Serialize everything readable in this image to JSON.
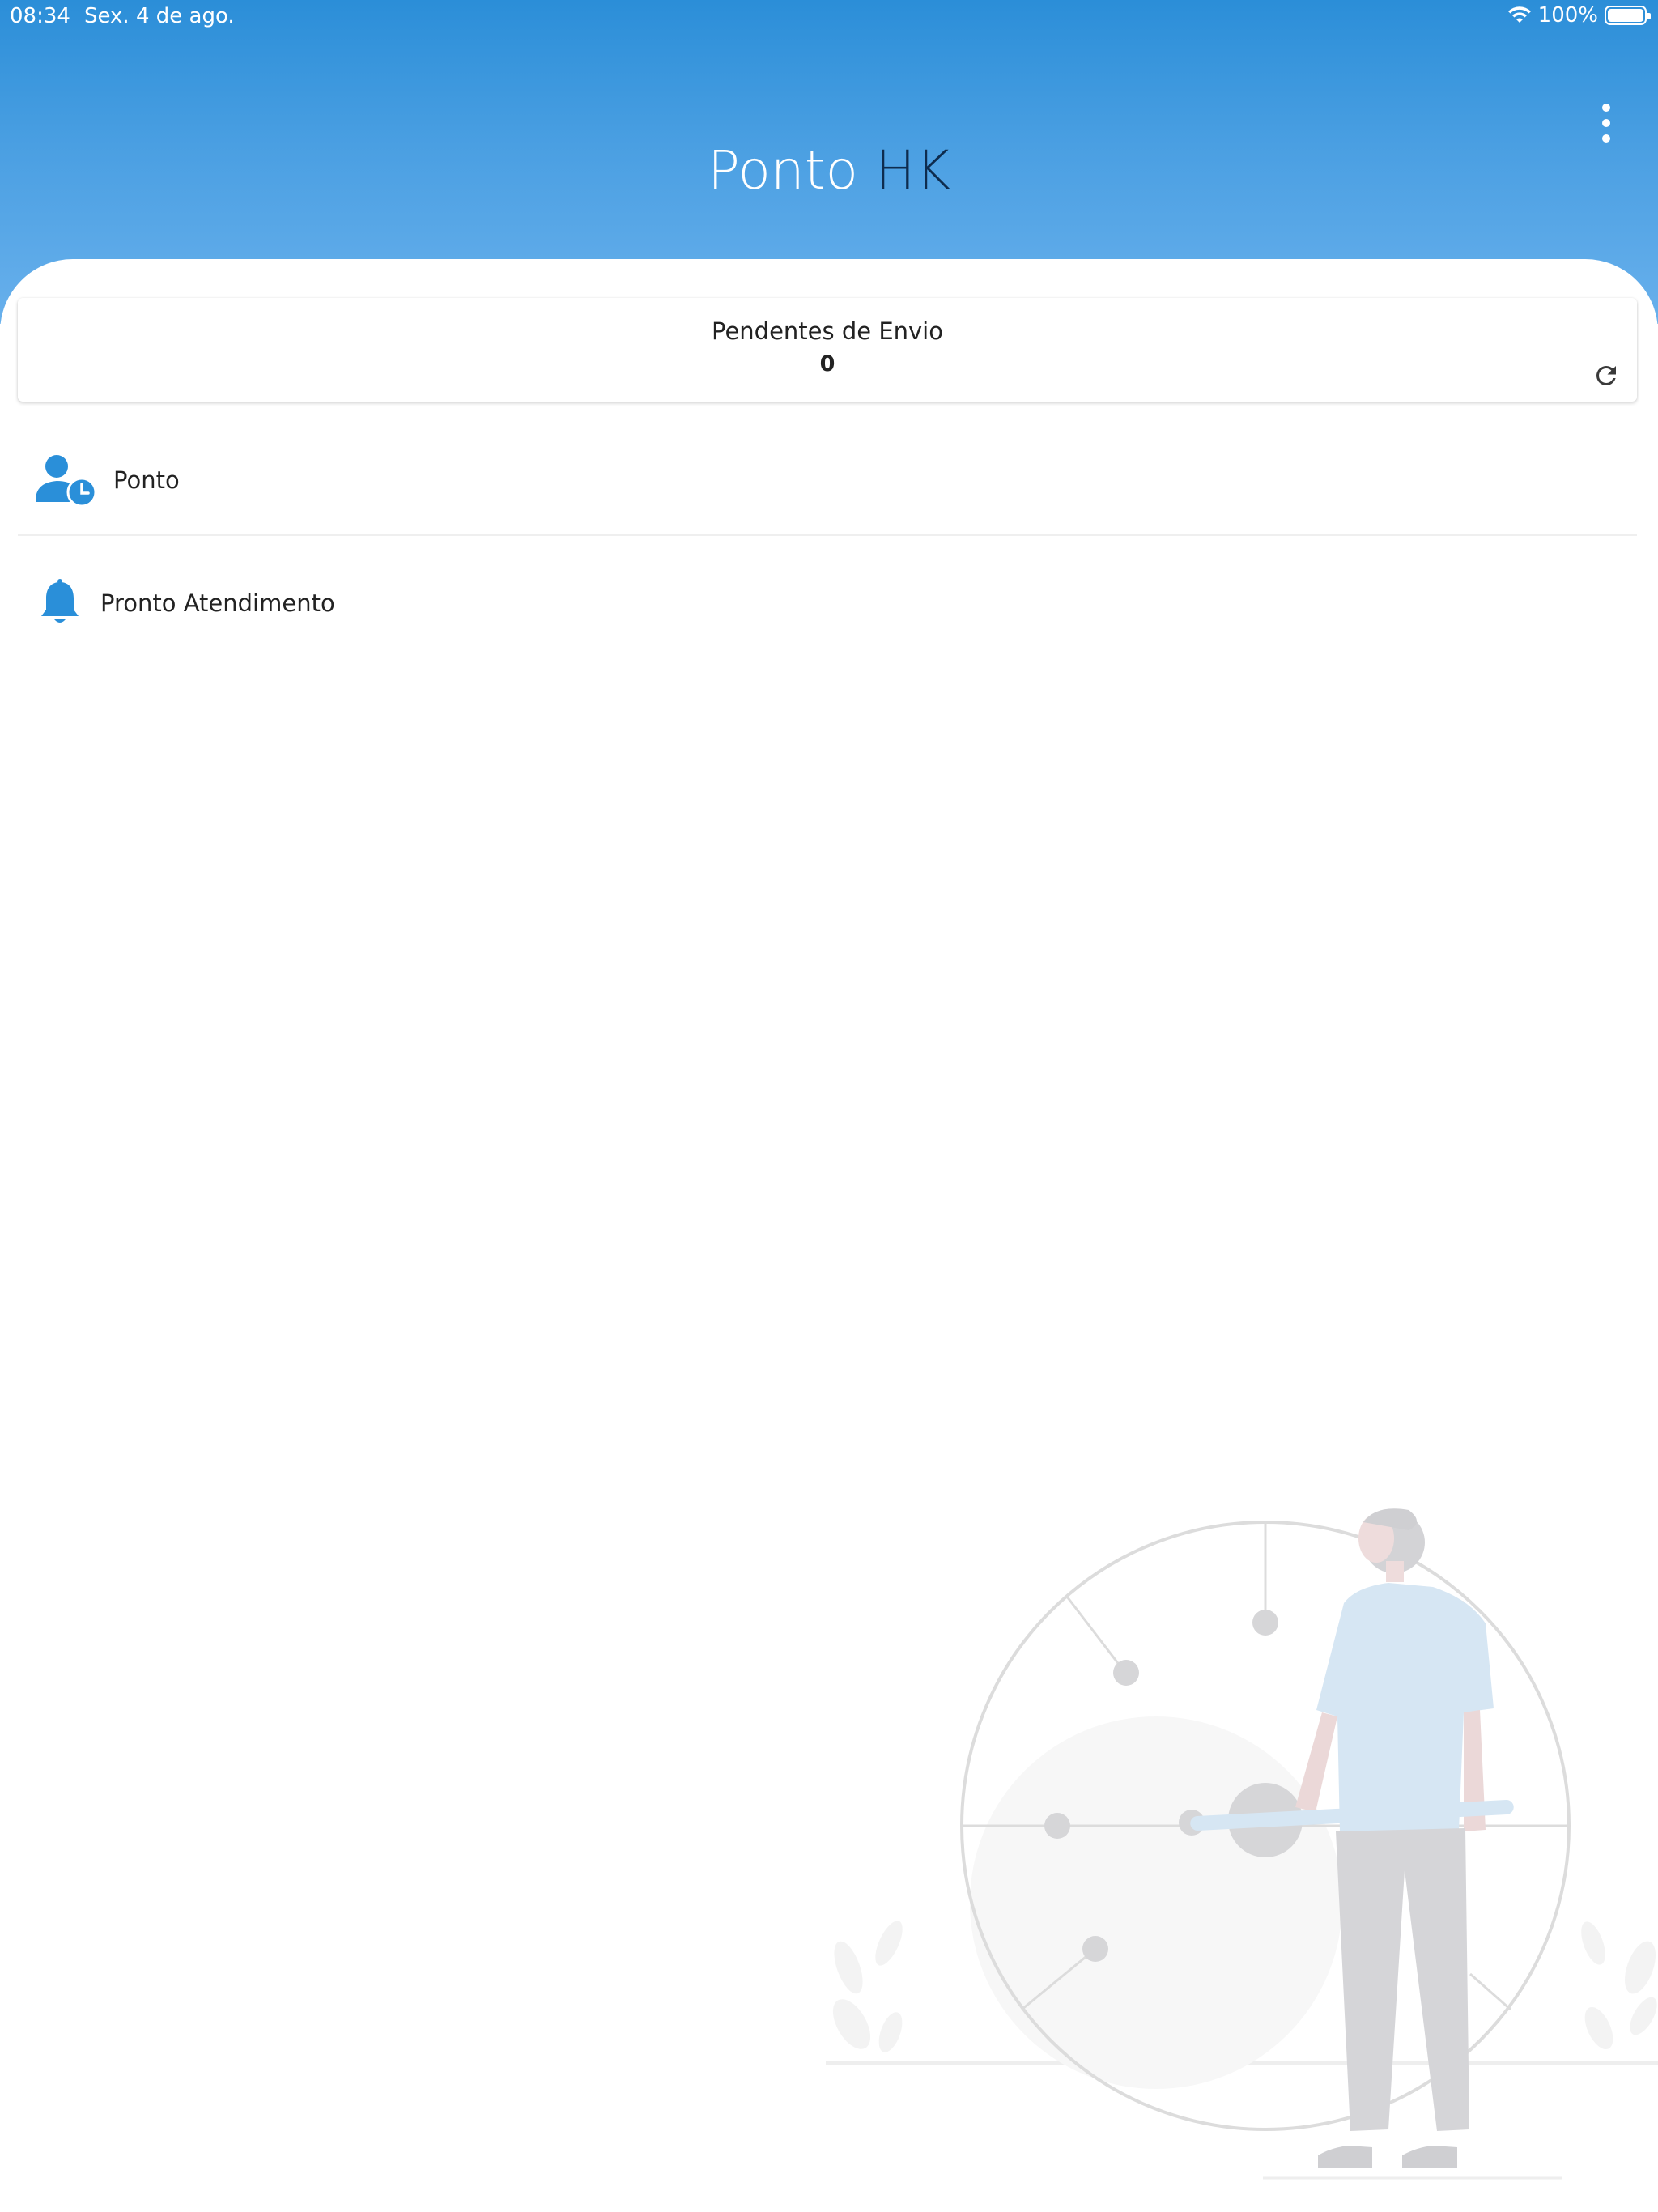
{
  "status_bar": {
    "time": "08:34",
    "date": "Sex. 4 de ago.",
    "battery": "100%"
  },
  "header": {
    "title_part1": "Ponto",
    "title_part2": "HK"
  },
  "pending": {
    "label": "Pendentes de Envio",
    "count": "0"
  },
  "menu": [
    {
      "label": "Ponto",
      "icon": "user-clock-icon"
    },
    {
      "label": "Pronto Atendimento",
      "icon": "bell-icon"
    }
  ],
  "colors": {
    "accent": "#2a8fd9",
    "header_top": "#2b8ed8",
    "header_bottom": "#68b0ec",
    "title_dark": "#0e2c4e"
  }
}
